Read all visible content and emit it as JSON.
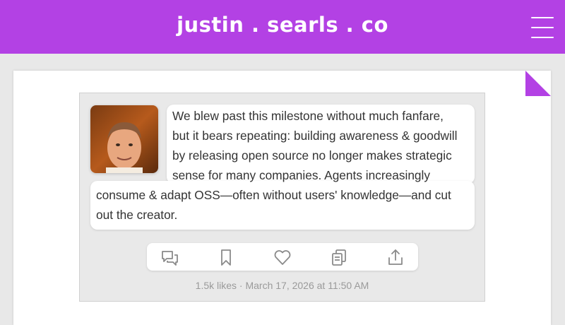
{
  "header": {
    "site_title": "justin . searls . co",
    "menu_icon": "hamburger-menu-icon"
  },
  "post": {
    "text_lines": [
      "We blew past this milestone without much fanfare,",
      "but it bears repeating: building awareness & goodwill",
      "by releasing open source no longer makes strategic",
      "sense for many companies. Agents increasingly",
      "consume & adapt OSS—often without users' knowledge—and cut",
      "out the creator."
    ],
    "actions": [
      {
        "name": "comment",
        "icon": "speech-bubbles-icon"
      },
      {
        "name": "bookmark",
        "icon": "bookmark-icon"
      },
      {
        "name": "like",
        "icon": "heart-icon"
      },
      {
        "name": "copy",
        "icon": "copy-icon"
      },
      {
        "name": "share",
        "icon": "share-icon"
      }
    ],
    "meta": "1.5k likes · March 17, 2026 at 11:50 AM"
  },
  "colors": {
    "brand": "#b341e4",
    "page_bg": "#e8e8e8",
    "text": "#333333",
    "meta": "#9a9a9a"
  }
}
